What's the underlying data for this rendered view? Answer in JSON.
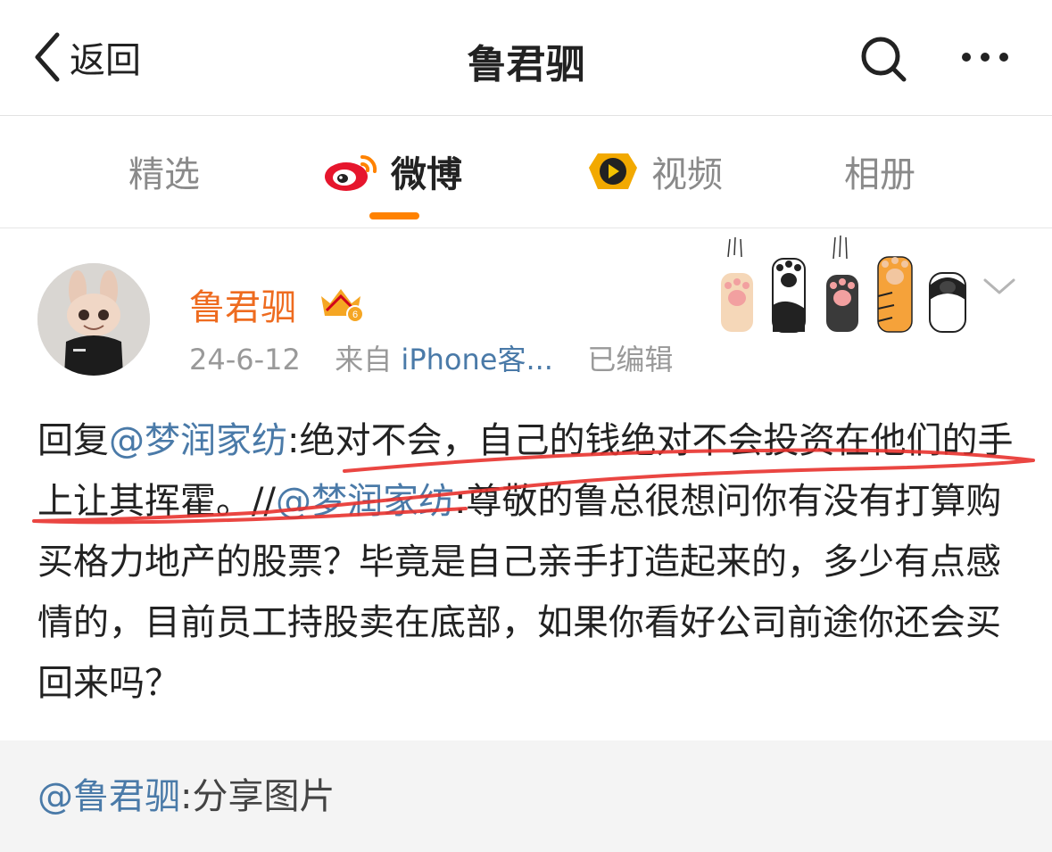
{
  "nav": {
    "back_label": "返回",
    "title": "鲁君驷"
  },
  "tabs": [
    {
      "label": "精选",
      "active": false
    },
    {
      "label": "微博",
      "active": true,
      "icon": "weibo-logo-icon"
    },
    {
      "label": "视频",
      "active": false,
      "icon": "video-play-icon"
    },
    {
      "label": "相册",
      "active": false
    }
  ],
  "post": {
    "author": "鲁君驷",
    "badge_level": "6",
    "date": "24-6-12",
    "source_prefix": "来自",
    "source": "iPhone客...",
    "edited": "已编辑",
    "body": {
      "reply_prefix": "回复",
      "mention1": "@梦润家纺",
      "reply": ":绝对不会，自己的钱绝对不会投资在他们的手上让其挥霍。",
      "sep": "//",
      "mention2": "@梦润家纺",
      "quoted": ":尊敬的鲁总很想问你有没有打算购买格力地产的股票？毕竟是自己亲手打造起来的，多少有点感情的，目前员工持股卖在底部，如果你看好公司前途你还会买回来吗？"
    }
  },
  "retweet": {
    "mention": "@鲁君驷",
    "text": ":分享图片"
  },
  "colors": {
    "accent": "#ff8200",
    "author": "#ee6b1f",
    "link": "#4a7aa8",
    "annotation": "#e8322d"
  }
}
